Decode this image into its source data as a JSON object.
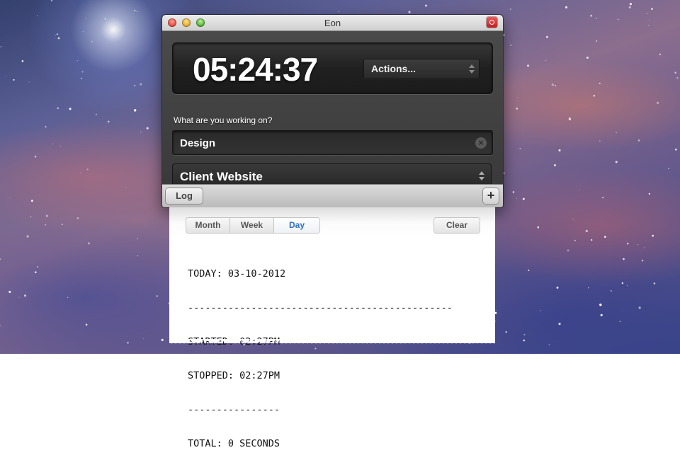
{
  "window": {
    "title": "Eon"
  },
  "timer": {
    "value": "05:24:37"
  },
  "actions": {
    "label": "Actions..."
  },
  "task": {
    "prompt": "What are you working on?",
    "value": "Design"
  },
  "project": {
    "value": "Client Website"
  },
  "bottom_bar": {
    "log_label": "Log",
    "add_label": "+"
  },
  "log": {
    "tabs": [
      {
        "label": "Month"
      },
      {
        "label": "Week"
      },
      {
        "label": "Day",
        "active": true
      }
    ],
    "clear_label": "Clear",
    "lines": [
      "TODAY: 03-10-2012",
      "----------------------------------------------",
      "STARTED: 02:27PM",
      "STOPPED: 02:27PM",
      "----------------",
      "TOTAL: 0 SECONDS"
    ]
  },
  "colors": {
    "active_tab": "#2f6fc0",
    "close_badge": "#d42a2a"
  }
}
